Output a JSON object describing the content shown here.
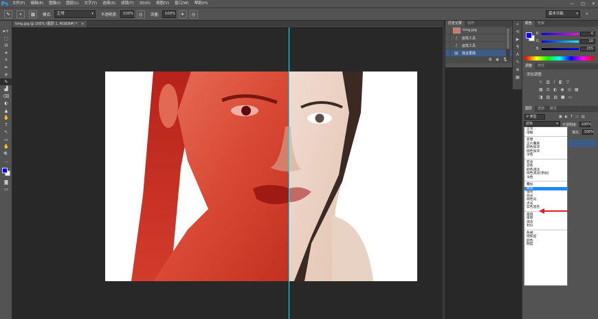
{
  "app": {
    "logo": "Ps",
    "menu": [
      "文件(F)",
      "编辑(E)",
      "图像(I)",
      "图层(L)",
      "文字(Y)",
      "选择(S)",
      "滤镜(T)",
      "3D(D)",
      "视图(V)",
      "窗口(W)",
      "帮助(H)"
    ],
    "window_controls": [
      "—",
      "□",
      "✕"
    ]
  },
  "options_bar": {
    "mode_label": "模式:",
    "mode_value": "正常",
    "opacity_label": "不透明度:",
    "opacity_value": "100%",
    "flow_label": "流量:",
    "flow_value": "100%",
    "workspace": "基本功能"
  },
  "document": {
    "tab_title": "timg.jpg @ 100% (图层 1, RGB/8#) *",
    "tab_close": "×"
  },
  "history_panel": {
    "tabs": [
      "历史记录",
      "动作"
    ],
    "items": [
      {
        "label": "timg.jpg",
        "icon": "thumbnail"
      },
      {
        "label": "画笔工具",
        "icon": "brush-icon"
      },
      {
        "label": "画笔工具",
        "icon": "brush-icon"
      },
      {
        "label": "混合更改",
        "icon": "blend-icon"
      }
    ],
    "footer_icons": [
      "⧉",
      "◉",
      "🗑"
    ]
  },
  "color_panel": {
    "tabs": [
      "颜色",
      "色板"
    ],
    "fg_color": "#0000ff",
    "bg_color": "#ffffff",
    "channels": [
      {
        "label": "R",
        "value": "0"
      },
      {
        "label": "G",
        "value": "10"
      },
      {
        "label": "B",
        "value": "255"
      }
    ]
  },
  "adjustments_panel": {
    "tabs": [
      "调整",
      "样式"
    ],
    "title": "添加调整"
  },
  "layers_panel": {
    "tabs": [
      "图层",
      "通道",
      "路径"
    ],
    "filter_label": "P 类型",
    "blend_value": "滤色",
    "opacity_label": "不透明度:",
    "opacity_value": "100%",
    "fill_label": "填充:",
    "fill_value": "100%"
  },
  "blend_modes": [
    [
      "正常",
      "溶解"
    ],
    [
      "变暗",
      "正片叠底",
      "颜色加深",
      "线性加深",
      "深色"
    ],
    [
      "变亮",
      "滤色",
      "颜色减淡",
      "线性减淡(添加)",
      "浅色"
    ],
    [
      "叠加",
      "柔光",
      "强光",
      "亮光",
      "线性光",
      "点光",
      "实色混合"
    ],
    [
      "差值",
      "排除",
      "减去",
      "划分"
    ],
    [
      "色相",
      "饱和度",
      "颜色",
      "明度"
    ]
  ],
  "blend_selected": "柔光",
  "tools": [
    "▸+",
    "⬚",
    "ʘ",
    "✦",
    "⌗",
    "✒",
    "⌀",
    "✎",
    "▟",
    "⌫",
    "◐",
    "▲",
    "✋",
    "T",
    "↖",
    "▭",
    "✋",
    "🔍",
    "…"
  ],
  "colors": {
    "accent_selected": "#3c5c86",
    "dropdown_highlight": "#1f8aff",
    "guide": "#4ad1d6",
    "arrow": "#e02020"
  }
}
